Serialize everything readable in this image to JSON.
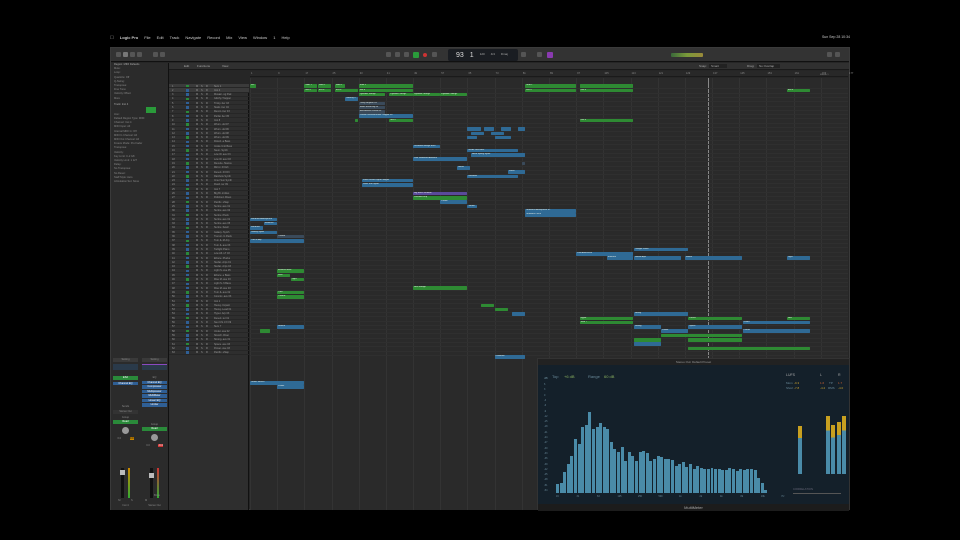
{
  "menubar": {
    "apple": "",
    "items": [
      "Logic Pro",
      "File",
      "Edit",
      "Track",
      "Navigate",
      "Record",
      "Mix",
      "View",
      "Window",
      "1",
      "Help"
    ],
    "clock": "Sun Sep 28 10:34"
  },
  "transport": {
    "bar": "93",
    "beat": "1",
    "tempo": "120",
    "signature": "4/4",
    "key": "Dmaj"
  },
  "arrange_toolbar": {
    "edit": "Edit",
    "functions": "Functions",
    "view": "View",
    "snap_label": "Snap:",
    "snap": "Smart",
    "drag_label": "Drag:",
    "drag": "No Overlap"
  },
  "inspector": {
    "region_header": "Region: MIDI Defaults",
    "region_rows": [
      "Mute:",
      "Loop:",
      "Quantize: Off",
      "Q-Swing:",
      "Transpose:",
      "Fine Tune:",
      "Velocity Offset:",
      "More"
    ],
    "track_header": "Track: Inst 4",
    "track_rows": [
      "Icon:",
      "Default Region Type: MIDI",
      "Channel: Inst 4",
      "MIDI Input: All",
      "Internal MIDI In: Off",
      "MIDI In Channel: All",
      "MIDI Out Channel: All",
      "Freeze Mode: Pre Fader",
      "Transpose:",
      "Velocity:",
      "Key Limit: C-2  G8",
      "Velocity Limit: 1  127",
      "Delay:",
      "No Transpose:",
      "No Reset:",
      "Staff Style: Auto",
      "Articulation Set: None"
    ]
  },
  "mixer": {
    "strip1": {
      "setting": "Setting",
      "eq": "EQ",
      "plugin1": "ES2",
      "plugin2": "Channel EQ",
      "sends": "Sends",
      "output": "Stereo Out",
      "group": "Group",
      "automation": "Read",
      "pan": "0.0",
      "gain": "0.0",
      "name": "Inst 4",
      "mute": "M",
      "solo": "S"
    },
    "strip2": {
      "setting": "Setting",
      "eq": "EQ",
      "plugins": [
        "Channel EQ",
        "Compressor",
        "Multipressor",
        "MultiMeter",
        "Linear EQ",
        "Limiter"
      ],
      "group": "Group",
      "automation": "Read",
      "pan": "0.0",
      "gain": "-0.4",
      "name": "Stereo Out",
      "bounce": "Bnce",
      "mute": "M"
    }
  },
  "ruler": {
    "bars": [
      "1",
      "9",
      "17",
      "25",
      "33",
      "41",
      "49",
      "57",
      "65",
      "73",
      "81",
      "89",
      "97",
      "105",
      "113",
      "121",
      "129",
      "137",
      "145",
      "153",
      "161",
      "169",
      "177"
    ],
    "marker": "Marker 1"
  },
  "tracks": [
    "Sum 1",
    "Inst 4",
    "Mosaic..ng Pad",
    "Glitchy Trapper",
    "Tricky..ber 03",
    "Static..ber 04",
    "Recon..ber 03",
    "Parfai..ber 05",
    "Inst 8",
    "Wrum..uld 07",
    "Wrum..uld 06",
    "Wrum..uld 08",
    "Wrum..uld 09",
    "Distort..a Bass",
    "Inside Unit Bass",
    "Neon..Synth",
    "Low W..ave F3",
    "Low W..ave D3",
    "Reverie..Stance",
    "Mirror..F3 E3",
    "Desert..F3 D3",
    "Rainbow Synth",
    "Inner Sun Synth",
    "Flash..ter 09",
    "Inst 7",
    "Big Br..imbles",
    "Polished..Rises",
    "Pacific..shlap",
    "Sunbu..ave 01",
    "Sunbu..ave 02",
    "Sunbu..Pluck",
    "Sunbu..ave 01",
    "Sunbu..ave 05",
    "Sunbu..Swell",
    "Galaxy..Synth",
    "Tremor..In Pads",
    "Turn &..M Arp",
    "Turn &..ave 03",
    "Twilight Piano",
    "Low Aft..LT 03",
    "Ethere..Plucks",
    "Stellar..Arps 01",
    "Stellar..Arps 03",
    "Light S..ave 05",
    "Ethere..e Bass",
    "Rise M..ave 03",
    "Light S..ft Bass",
    "Rise M..ave 03",
    "Turn &..ave 02",
    "Cosmic..ave 03",
    "Inst 1",
    "Heavy..Impact",
    "Heavy..Lead 01",
    "Hyper..Arp 03",
    "Desert..ter 01",
    "Neo Chi..FX 09",
    "Sum 7",
    "Under..ave 02",
    "Stretch..Riser",
    "Strong..ave 01",
    "Space..ave 03",
    "Power..ave 03",
    "Pacific..shlap"
  ],
  "regions": [
    [
      0,
      1,
      3,
      "Su..",
      "g"
    ],
    [
      0,
      17,
      21,
      "Sum 1",
      "g"
    ],
    [
      0,
      21,
      25,
      "Sum 1",
      "g"
    ],
    [
      0,
      26,
      29,
      "Sum 1",
      "g"
    ],
    [
      0,
      33,
      49,
      "Sum 1",
      "g"
    ],
    [
      0,
      82,
      97,
      "Sum 1",
      "g"
    ],
    [
      0,
      98,
      114,
      "",
      "g"
    ],
    [
      1,
      17,
      21,
      "Inst 4",
      "g"
    ],
    [
      1,
      21,
      25,
      "Inst 4",
      "g"
    ],
    [
      1,
      26,
      33,
      "Inst 4",
      "g"
    ],
    [
      1,
      33,
      49,
      "Inst 4",
      "g"
    ],
    [
      1,
      82,
      97,
      "Inst 4",
      "g"
    ],
    [
      1,
      98,
      114,
      "Inst 4",
      "g"
    ],
    [
      1,
      159,
      166,
      "Inst 4",
      "g"
    ],
    [
      2,
      33,
      41,
      "Dynamic Strings",
      "g"
    ],
    [
      2,
      42,
      49,
      "Dynamic Strings",
      "g"
    ],
    [
      2,
      49,
      57,
      "Dynamic Strings",
      "g"
    ],
    [
      2,
      57,
      65,
      "Dynamic Strings",
      "g"
    ],
    [
      3,
      29,
      33,
      "Velocity 3",
      "b"
    ],
    [
      4,
      33,
      41,
      "Tricky Rhythm 03",
      "d"
    ],
    [
      5,
      33,
      41,
      "Static Electricity 04",
      "d"
    ],
    [
      6,
      33,
      41,
      "Reconstruct Phase 03",
      "d"
    ],
    [
      7,
      33,
      49,
      "Parfait Deconstruction Trapper 05",
      "b"
    ],
    [
      8,
      32,
      33,
      "",
      "g"
    ],
    [
      8,
      42,
      49,
      "Inst 4",
      "g"
    ],
    [
      8,
      98,
      114,
      "Inst 4",
      "g"
    ],
    [
      10,
      65,
      69,
      "",
      "b"
    ],
    [
      10,
      70,
      73,
      "",
      "b"
    ],
    [
      10,
      75,
      78,
      "",
      "b"
    ],
    [
      10,
      80,
      82,
      "",
      "b"
    ],
    [
      11,
      66,
      70,
      "",
      "b"
    ],
    [
      11,
      72,
      76,
      "",
      "b"
    ],
    [
      12,
      65,
      68,
      "",
      "b"
    ],
    [
      12,
      73,
      78,
      "",
      "b"
    ],
    [
      14,
      49,
      57,
      "Distorted Mirage Bass",
      "b"
    ],
    [
      15,
      65,
      80,
      "Inside Unit Bass",
      "b"
    ],
    [
      16,
      66,
      82,
      "Neon Spring Synth",
      "b"
    ],
    [
      17,
      49,
      65,
      "Low Wideward Ambient",
      "b"
    ],
    [
      18,
      81,
      82,
      "",
      "d"
    ],
    [
      19,
      62,
      66,
      "Mirror",
      "b"
    ],
    [
      20,
      77,
      82,
      "Flash",
      "b"
    ],
    [
      21,
      65,
      80,
      "Rainbow",
      "b"
    ],
    [
      22,
      34,
      49,
      "Flash Desert Synth Stages",
      "b"
    ],
    [
      23,
      34,
      49,
      "Inner Sun Synth",
      "b"
    ],
    [
      25,
      49,
      65,
      "Big Brass Rumble",
      "p"
    ],
    [
      26,
      49,
      65,
      "Polished Drip",
      "g"
    ],
    [
      27,
      57,
      65,
      "Pacific",
      "b"
    ],
    [
      28,
      65,
      68,
      "Sunbu",
      "b"
    ],
    [
      29,
      82,
      97,
      "Sunburst Atmosphere 01",
      "b"
    ],
    [
      30,
      82,
      97,
      "Sunburst Pluck",
      "b"
    ],
    [
      31,
      1,
      9,
      "Sunburst Atmosphere",
      "b"
    ],
    [
      32,
      5,
      9,
      "Sunburst",
      "b"
    ],
    [
      33,
      1,
      5,
      "Sunburst",
      "b"
    ],
    [
      34,
      1,
      9,
      "Galaxy Synth",
      "b"
    ],
    [
      35,
      9,
      17,
      "Tremor",
      "d"
    ],
    [
      36,
      1,
      17,
      "Turn & Arp",
      "b"
    ],
    [
      39,
      97,
      114,
      "Low Aftershock",
      "b"
    ],
    [
      40,
      106,
      114,
      "Ethereal",
      "b"
    ],
    [
      40,
      114,
      128,
      "Stellar Arps",
      "b"
    ],
    [
      40,
      129,
      146,
      "Stellar",
      "b"
    ],
    [
      40,
      159,
      166,
      "Light",
      "b"
    ],
    [
      38,
      114,
      130,
      "Twilight Piano",
      "b"
    ],
    [
      43,
      9,
      17,
      "Ethereal Rise",
      "g"
    ],
    [
      44,
      9,
      13,
      "Rise",
      "g"
    ],
    [
      45,
      13,
      17,
      "Light",
      "g"
    ],
    [
      47,
      49,
      65,
      "Rise Mirage",
      "g"
    ],
    [
      48,
      9,
      17,
      "Turn",
      "g"
    ],
    [
      49,
      9,
      17,
      "Cosmic",
      "g"
    ],
    [
      51,
      69,
      73,
      "",
      "g"
    ],
    [
      52,
      73,
      77,
      "",
      "g"
    ],
    [
      53,
      78,
      82,
      "",
      "b"
    ],
    [
      53,
      114,
      130,
      "Heavy",
      "b"
    ],
    [
      54,
      98,
      114,
      "Hyper",
      "g"
    ],
    [
      54,
      130,
      146,
      "Desert",
      "g"
    ],
    [
      54,
      159,
      166,
      "Neo",
      "g"
    ],
    [
      55,
      98,
      114,
      "Sum 7",
      "g"
    ],
    [
      55,
      146,
      166,
      "Under",
      "b"
    ],
    [
      56,
      9,
      17,
      "Stretch",
      "b"
    ],
    [
      56,
      114,
      122,
      "Strong",
      "b"
    ],
    [
      56,
      130,
      146,
      "Space",
      "b"
    ],
    [
      57,
      4,
      7,
      "",
      "g"
    ],
    [
      57,
      122,
      130,
      "Power",
      "b"
    ],
    [
      57,
      146,
      166,
      "Pacific",
      "b"
    ],
    [
      58,
      122,
      130,
      "",
      "g"
    ],
    [
      58,
      130,
      146,
      "",
      "g"
    ],
    [
      59,
      114,
      122,
      "",
      "g"
    ],
    [
      59,
      130,
      146,
      "",
      "g"
    ],
    [
      60,
      114,
      122,
      "",
      "b"
    ],
    [
      61,
      130,
      166,
      "",
      "g"
    ],
    [
      63,
      73,
      82,
      "Distorted",
      "b"
    ],
    [
      69,
      1,
      17,
      "Under Stretch",
      "b"
    ],
    [
      70,
      9,
      17,
      "Power",
      "b"
    ]
  ],
  "colors": {
    "g": "#2e8a33",
    "b": "#2f6a95",
    "d": "#3a4a5a",
    "p": "#5a4a9a"
  },
  "multimeter": {
    "title": "Stereo Out: Default Preset",
    "top_label": "Top",
    "top_value": "+6 dB",
    "range_label": "Range",
    "range_value": "60 dB",
    "db_unit": "dB",
    "db_ticks": [
      "6",
      "3",
      "0",
      "-3",
      "-6",
      "-9",
      "-12",
      "-15",
      "-18",
      "-21",
      "-24",
      "-27",
      "-30",
      "-33",
      "-36",
      "-39",
      "-42",
      "-45",
      "-48",
      "-51",
      "-54"
    ],
    "freq_ticks": [
      "16",
      "31",
      "63",
      "125",
      "250",
      "500",
      "1k",
      "2k",
      "4k",
      "8k",
      "16k",
      "Hz"
    ],
    "spectrum_levels": [
      0.08,
      0.09,
      0.19,
      0.26,
      0.34,
      0.49,
      0.45,
      0.6,
      0.62,
      0.74,
      0.58,
      0.6,
      0.64,
      0.6,
      0.58,
      0.46,
      0.4,
      0.37,
      0.42,
      0.29,
      0.37,
      0.34,
      0.29,
      0.37,
      0.38,
      0.36,
      0.29,
      0.31,
      0.34,
      0.33,
      0.31,
      0.31,
      0.3,
      0.25,
      0.26,
      0.28,
      0.24,
      0.26,
      0.22,
      0.25,
      0.23,
      0.22,
      0.22,
      0.23,
      0.22,
      0.22,
      0.21,
      0.21,
      0.23,
      0.22,
      0.2,
      0.22,
      0.21,
      0.22,
      0.22,
      0.21,
      0.14,
      0.09,
      0.03
    ],
    "lufs": {
      "label": "LUFS",
      "l": "L",
      "r": "R",
      "mom_label": "Mom",
      "mom": "-9.3",
      "short_label": "Short",
      "short": "-7.8",
      "pk_label": "TP",
      "l_peak": "1.6",
      "r_peak": "1.7",
      "rms_label": "RMS",
      "l_rms": "-4.2",
      "r_rms": "-4.0"
    },
    "lufs_level": 0.6,
    "l_level": 0.72,
    "r_level": 0.72,
    "correlation": "CORRELATION",
    "footer": "MultiMeter"
  }
}
